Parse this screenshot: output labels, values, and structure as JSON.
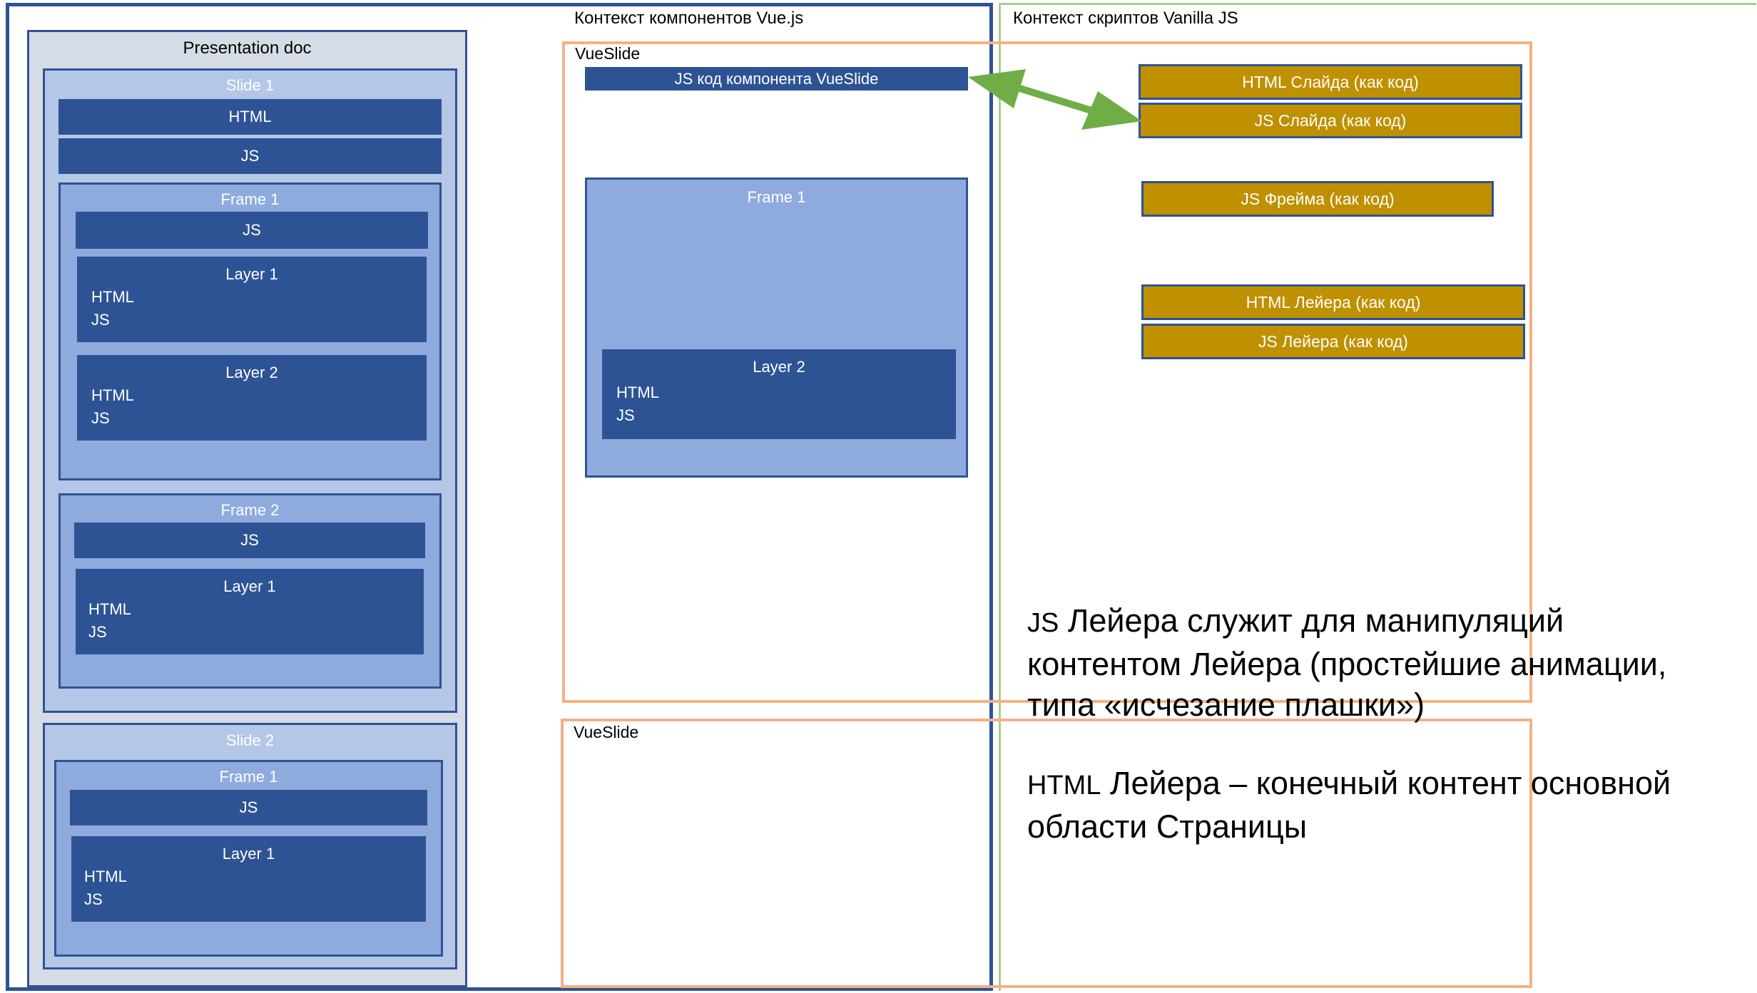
{
  "vue_context": {
    "label": "Контекст компонентов Vue.js"
  },
  "vanilla_context": {
    "label": "Контекст скриптов Vanilla JS"
  },
  "presentation_doc": {
    "title": "Presentation doc",
    "slide1": {
      "title": "Slide 1",
      "html": "HTML",
      "js": "JS",
      "frame1": {
        "title": "Frame 1",
        "js": "JS",
        "layer1": {
          "title": "Layer 1",
          "html": "HTML",
          "js": "JS"
        },
        "layer2": {
          "title": "Layer 2",
          "html": "HTML",
          "js": "JS"
        }
      },
      "frame2": {
        "title": "Frame 2",
        "js": "JS",
        "layer1": {
          "title": "Layer 1",
          "html": "HTML",
          "js": "JS"
        }
      }
    },
    "slide2": {
      "title": "Slide 2",
      "frame1": {
        "title": "Frame 1",
        "js": "JS",
        "layer1": {
          "title": "Layer 1",
          "html": "HTML",
          "js": "JS"
        }
      }
    }
  },
  "vueslide1": {
    "label": "VueSlide",
    "component_code": "JS код компонента VueSlide",
    "frame": {
      "title": "Frame 1",
      "layer": {
        "title": "Layer 2",
        "html": "HTML",
        "js": "JS"
      }
    }
  },
  "vueslide2": {
    "label": "VueSlide"
  },
  "code_blocks": {
    "slide_html": "HTML Слайда  (как код)",
    "slide_js": "JS Слайда (как код)",
    "frame_js": "JS Фрейма (как код)",
    "layer_html": "HTML Лейера  (как код)",
    "layer_js": "JS Лейера (как код)"
  },
  "notes": {
    "layer_js": {
      "term": "JS",
      "line1": " Лейера служит для манипуляций",
      "line2": "контентом Лейера (простейшие анимации,",
      "line3": "типа «исчезание плашки»)"
    },
    "layer_html": {
      "term": "HTML",
      "line1": " Лейера – конечный контент основной",
      "line2": "области Страницы"
    }
  },
  "colors": {
    "dark_blue": "#2e5395",
    "mid_blue": "#8faadc",
    "light_blue": "#b4c7e7",
    "doc_gray": "#d6dce5",
    "gold": "#bf9000",
    "orange_outline": "#f4b183",
    "green_arrow": "#70ad47",
    "green_outline": "#a8cf8e"
  }
}
